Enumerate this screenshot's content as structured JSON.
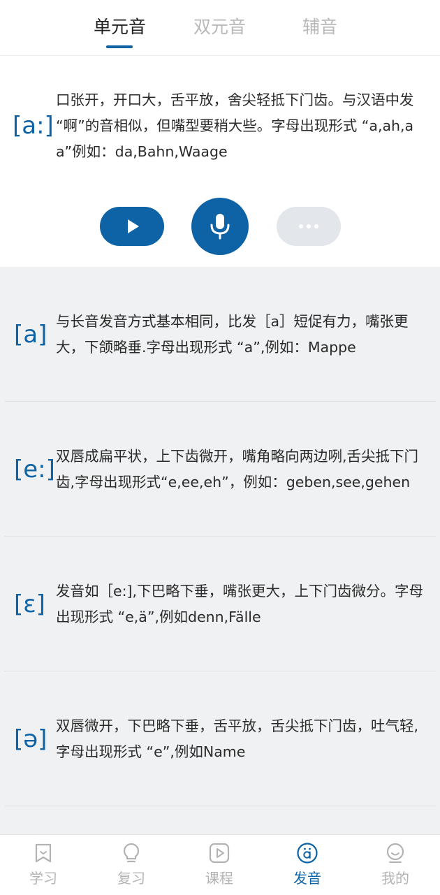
{
  "tabs": [
    {
      "label": "单元音",
      "active": true
    },
    {
      "label": "双元音",
      "active": false
    },
    {
      "label": "辅音",
      "active": false
    }
  ],
  "featured": {
    "symbol": "[a:]",
    "description": "口张开，开口大，舌平放，舍尖轻抵下门齿。与汉语中发 “啊”的音相似，但嘴型要稍大些。字母出现形式 “a,ah,aa”例如：da,Bahn,Waage",
    "controls": {
      "play_icon": "play-icon",
      "record_icon": "microphone-icon",
      "more_icon": "more-dots-icon"
    }
  },
  "phonemes": [
    {
      "symbol": "[a]",
      "description": "与长音发音方式基本相同，比发［a］短促有力，嘴张更大，下颌略垂.字母出现形式 “a”,例如：Mappe"
    },
    {
      "symbol": "[e:]",
      "description": "双唇成扁平状，上下齿微开，嘴角略向两边咧,舌尖抵下门齿,字母出现形式“e,ee,eh”，例如：geben,see,gehen"
    },
    {
      "symbol": "[ɛ]",
      "description": "发音如［e:],下巴略下垂，嘴张更大，上下门齿微分。字母出现形式 “e,ä”,例如denn,Fälle"
    },
    {
      "symbol": "[ə]",
      "description": "双唇微开，下巴略下垂，舌平放，舌尖抵下门齿，吐气轻,字母出现形式 “e”,例如Name"
    }
  ],
  "bottom_nav": [
    {
      "label": "学习",
      "icon": "bookmark-icon",
      "active": false
    },
    {
      "label": "复习",
      "icon": "lightbulb-icon",
      "active": false
    },
    {
      "label": "课程",
      "icon": "video-play-icon",
      "active": false
    },
    {
      "label": "发音",
      "icon": "umlaut-a-icon",
      "active": true
    },
    {
      "label": "我的",
      "icon": "smiley-face-icon",
      "active": false
    }
  ],
  "colors": {
    "accent": "#0d63a5",
    "inactive": "#b3b3b3",
    "list_background": "#f0f1f2",
    "more_button": "#e3e7eb"
  }
}
